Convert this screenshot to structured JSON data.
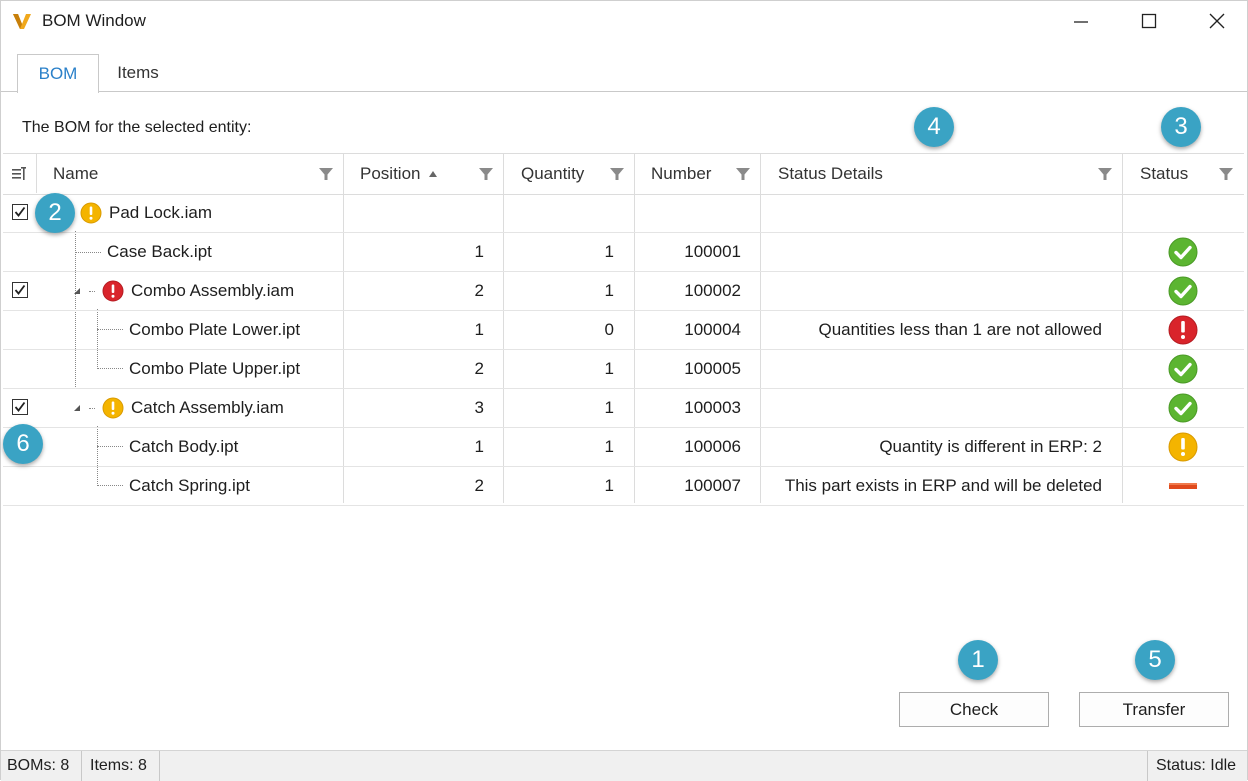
{
  "window": {
    "title": "BOM Window",
    "logo_letter": "V"
  },
  "tabs": [
    {
      "label": "BOM"
    },
    {
      "label": "Items"
    }
  ],
  "caption": "The BOM for the selected entity:",
  "columns": {
    "name": "Name",
    "position": "Position",
    "quantity": "Quantity",
    "number": "Number",
    "status_details": "Status Details",
    "status": "Status"
  },
  "rows": [
    {
      "name": "Pad Lock.iam",
      "position": "",
      "quantity": "",
      "number": "",
      "details": "",
      "icon": "warning-icon",
      "status": ""
    },
    {
      "name": "Case Back.ipt",
      "position": "1",
      "quantity": "1",
      "number": "100001",
      "details": "",
      "status": "ok"
    },
    {
      "name": "Combo Assembly.iam",
      "position": "2",
      "quantity": "1",
      "number": "100002",
      "details": "",
      "icon": "error-icon",
      "status": "ok"
    },
    {
      "name": "Combo Plate Lower.ipt",
      "position": "1",
      "quantity": "0",
      "number": "100004",
      "details": "Quantities less than 1 are not allowed",
      "status": "error"
    },
    {
      "name": "Combo Plate Upper.ipt",
      "position": "2",
      "quantity": "1",
      "number": "100005",
      "details": "",
      "status": "ok"
    },
    {
      "name": "Catch Assembly.iam",
      "position": "3",
      "quantity": "1",
      "number": "100003",
      "details": "",
      "icon": "warning-icon",
      "status": "ok"
    },
    {
      "name": "Catch Body.ipt",
      "position": "1",
      "quantity": "1",
      "number": "100006",
      "details": "Quantity is different in ERP: 2",
      "status": "warning"
    },
    {
      "name": "Catch Spring.ipt",
      "position": "2",
      "quantity": "1",
      "number": "100007",
      "details": "This part exists in ERP and will be deleted",
      "status": "delete"
    }
  ],
  "callouts": [
    "1",
    "2",
    "3",
    "4",
    "5",
    "6"
  ],
  "buttons": {
    "check": "Check",
    "transfer": "Transfer"
  },
  "statusbar": {
    "boms": "BOMs: 8",
    "items": "Items: 8",
    "status": "Status: Idle"
  },
  "colors": {
    "accent": "#2a80c9",
    "callout": "#3aa3c4",
    "ok": "#5cb531",
    "error": "#d9242b",
    "warning": "#f4b400",
    "delete": "#e04a1c"
  }
}
